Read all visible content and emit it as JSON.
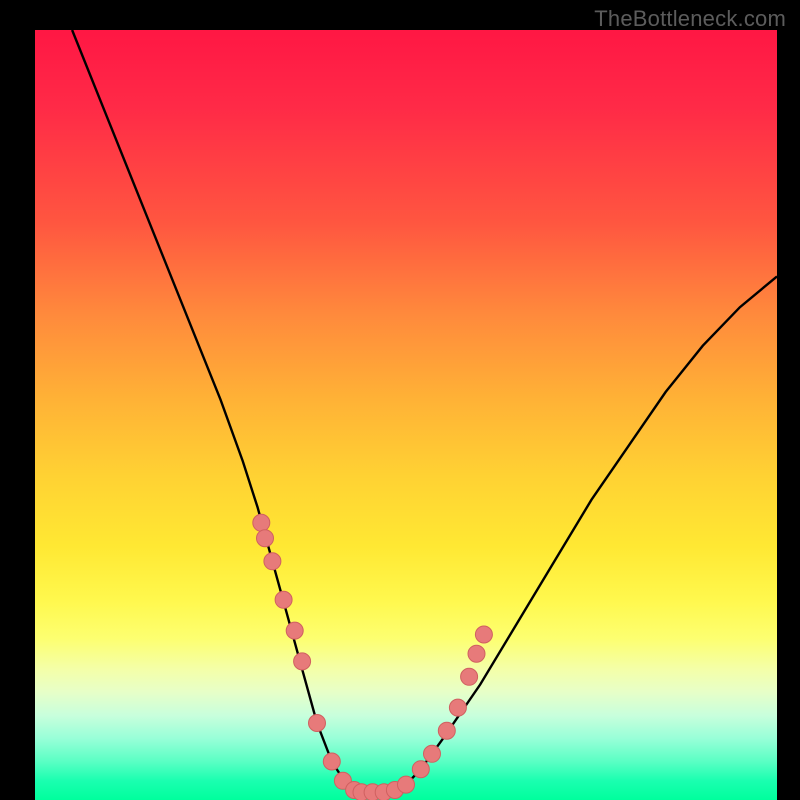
{
  "watermark": "TheBottleneck.com",
  "colors": {
    "frame": "#000000",
    "curve": "#000000",
    "dot_fill": "#e77a7a",
    "dot_stroke": "#d06060",
    "gradient_top": "#ff1744",
    "gradient_bottom": "#00ff9d"
  },
  "chart_data": {
    "type": "line",
    "title": "",
    "xlabel": "",
    "ylabel": "",
    "xlim": [
      0,
      100
    ],
    "ylim": [
      0,
      100
    ],
    "grid": false,
    "series": [
      {
        "name": "bottleneck-curve",
        "x": [
          5,
          10,
          15,
          20,
          25,
          28,
          30,
          32,
          34,
          36,
          38,
          40,
          42,
          44,
          46,
          48,
          50,
          52,
          55,
          60,
          65,
          70,
          75,
          80,
          85,
          90,
          95,
          100
        ],
        "values": [
          100,
          88,
          76,
          64,
          52,
          44,
          38,
          31,
          24,
          17,
          10,
          5,
          2,
          1,
          1,
          1,
          2,
          4,
          8,
          15,
          23,
          31,
          39,
          46,
          53,
          59,
          64,
          68
        ]
      }
    ],
    "markers": {
      "name": "highlighted-points",
      "x": [
        30.5,
        31.0,
        32.0,
        33.5,
        35.0,
        36.0,
        38.0,
        40.0,
        41.5,
        43.0,
        44.0,
        45.5,
        47.0,
        48.5,
        50.0,
        52.0,
        53.5,
        55.5,
        57.0,
        58.5,
        59.5,
        60.5
      ],
      "values": [
        36,
        34,
        31,
        26,
        22,
        18,
        10,
        5,
        2.5,
        1.3,
        1.0,
        1.0,
        1.0,
        1.3,
        2.0,
        4.0,
        6.0,
        9.0,
        12.0,
        16.0,
        19.0,
        21.5
      ]
    }
  }
}
